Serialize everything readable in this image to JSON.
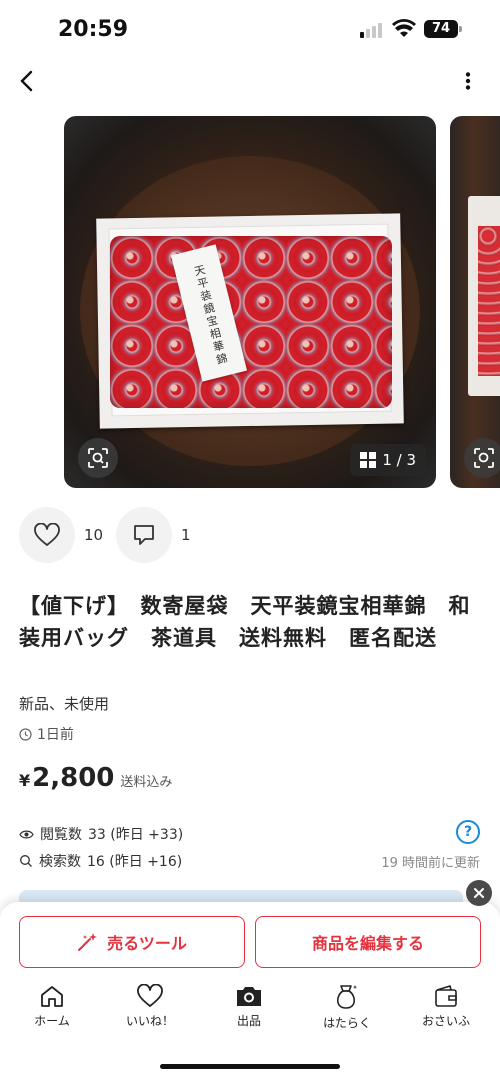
{
  "status_bar": {
    "time": "20:59",
    "battery": "74"
  },
  "gallery": {
    "page_current": "1",
    "page_total": "3",
    "page_label": "1 / 3",
    "label_card_text": "天平装鏡宝相華錦"
  },
  "reactions": {
    "likes": "10",
    "comments": "1"
  },
  "item": {
    "title": "【値下げ】　数寄屋袋　天平装鏡宝相華錦　和装用バッグ　茶道具　送料無料　匿名配送",
    "condition": "新品、未使用",
    "posted": "1日前",
    "price_symbol": "¥",
    "price": "2,800",
    "shipping": "送料込み"
  },
  "stats": {
    "views_label": "閲覧数",
    "views_value": "33 (昨日 +33)",
    "searches_label": "検索数",
    "searches_value": "16 (昨日 +16)",
    "help": "?",
    "updated": "19 時間前に更新"
  },
  "actions": {
    "sell_tool": "売るツール",
    "edit": "商品を編集する"
  },
  "tabs": [
    {
      "label": "ホーム",
      "icon": "home-icon"
    },
    {
      "label": "いいね！",
      "icon": "heart-icon"
    },
    {
      "label": "出品",
      "icon": "camera-icon"
    },
    {
      "label": "はたらく",
      "icon": "money-bag-icon"
    },
    {
      "label": "おさいふ",
      "icon": "wallet-icon"
    }
  ],
  "colors": {
    "accent": "#e5323f",
    "link": "#1a8ad6"
  }
}
